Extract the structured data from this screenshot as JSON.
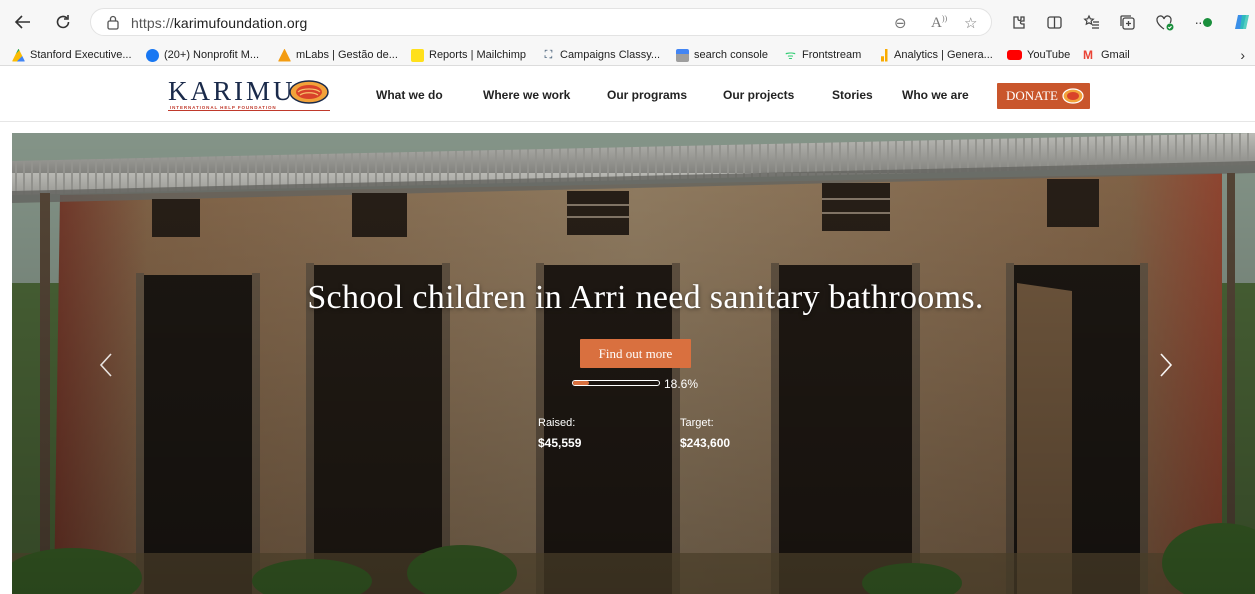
{
  "browser": {
    "url_protocol": "https://",
    "url_host": "karimufoundation.org",
    "icons": [
      "back-icon",
      "refresh-icon",
      "lock-icon",
      "zoom-icon",
      "read-aloud-icon",
      "favorite-icon",
      "extensions-icon",
      "split-screen-icon",
      "favorites-bar-icon",
      "collections-icon",
      "browser-essentials-icon",
      "more-icon"
    ]
  },
  "bookmarks": {
    "items": [
      {
        "label": "Stanford Executive...",
        "icon": "stanford-icon",
        "color": "#4285f4"
      },
      {
        "label": "(20+) Nonprofit M...",
        "icon": "facebook-icon",
        "color": "#1877f2"
      },
      {
        "label": "mLabs | Gestão de...",
        "icon": "mlabs-icon",
        "color": "#f39c12"
      },
      {
        "label": "Reports | Mailchimp",
        "icon": "mailchimp-icon",
        "color": "#ffe01b"
      },
      {
        "label": "Campaigns Classy...",
        "icon": "classy-icon",
        "color": "#1c3b5a"
      },
      {
        "label": "search console",
        "icon": "search-console-icon",
        "color": "#4285f4"
      },
      {
        "label": "Frontstream",
        "icon": "frontstream-icon",
        "color": "#2ecc71"
      },
      {
        "label": "Analytics | Genera...",
        "icon": "analytics-icon",
        "color": "#f9ab00"
      },
      {
        "label": "YouTube",
        "icon": "youtube-icon",
        "color": "#ff0000"
      },
      {
        "label": "Gmail",
        "icon": "gmail-icon",
        "color": "#ea4335"
      }
    ]
  },
  "site": {
    "logo_text": "KARIMU",
    "logo_tagline": "INTERNATIONAL HELP FOUNDATION",
    "nav": [
      "What we do",
      "Where we work",
      "Our programs",
      "Our projects",
      "Stories",
      "Who we are"
    ],
    "donate_label": "DONATE",
    "brand_color": "#c9562c",
    "accent_color": "#d9703f"
  },
  "hero": {
    "title": "School children in Arri need sanitary bathrooms.",
    "cta_label": "Find out more",
    "progress_fraction": 0.186,
    "progress_label": "18.6%",
    "raised_label": "Raised:",
    "raised_value": "$45,559",
    "target_label": "Target:",
    "target_value": "$243,600"
  }
}
